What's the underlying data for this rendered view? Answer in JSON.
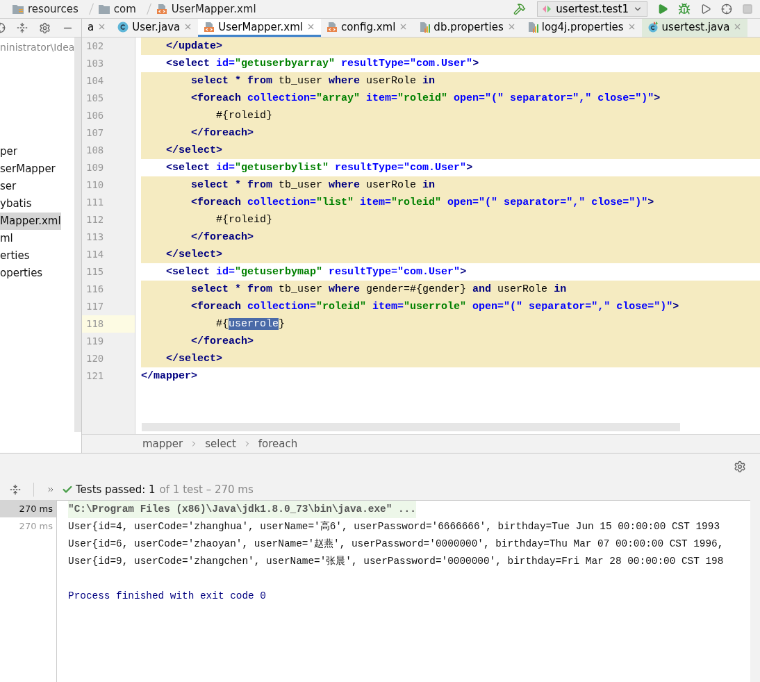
{
  "nav_bar": {
    "breadcrumbs": [
      {
        "text": "resources",
        "kind": "resources"
      },
      {
        "text": "com",
        "kind": "folder"
      },
      {
        "text": "UserMapper.xml",
        "kind": "xml"
      }
    ],
    "run_config": "usertest.test1"
  },
  "project_panel": {
    "tree_items": [
      {
        "text": "ninistrator\\Idea",
        "kind": "path",
        "selected": false
      },
      {
        "text": "per",
        "kind": "node",
        "selected": false
      },
      {
        "text": "serMapper",
        "kind": "node",
        "selected": false
      },
      {
        "text": "ser",
        "kind": "node",
        "selected": false
      },
      {
        "text": "ybatis",
        "kind": "node",
        "selected": false
      },
      {
        "text": "Mapper.xml",
        "kind": "node",
        "selected": true
      },
      {
        "text": "ml",
        "kind": "node",
        "selected": false
      },
      {
        "text": "erties",
        "kind": "node",
        "selected": false
      },
      {
        "text": "operties",
        "kind": "node",
        "selected": false
      }
    ]
  },
  "editor_tabs": [
    {
      "label": "a",
      "kind": "none",
      "selected": false
    },
    {
      "label": "User.java",
      "kind": "class",
      "selected": false
    },
    {
      "label": "UserMapper.xml",
      "kind": "xml",
      "selected": true
    },
    {
      "label": "config.xml",
      "kind": "xml",
      "selected": false
    },
    {
      "label": "db.properties",
      "kind": "properties",
      "selected": false
    },
    {
      "label": "log4j.properties",
      "kind": "properties",
      "selected": false
    },
    {
      "label": "usertest.java",
      "kind": "test-class",
      "selected": false
    }
  ],
  "editor": {
    "lines": [
      {
        "number": "102",
        "highlighted": true,
        "current": false,
        "tokens": [
          {
            "text": "    </update>",
            "kind": "tag"
          }
        ]
      },
      {
        "number": "103",
        "highlighted": false,
        "current": false,
        "tokens": [
          {
            "text": "    <select",
            "kind": "tag"
          },
          {
            "text": " id=",
            "kind": "attr"
          },
          {
            "text": "\"getuserbyarray\"",
            "kind": "value"
          },
          {
            "text": " resultType=\"com.User\"",
            "kind": "attr"
          },
          {
            "text": ">",
            "kind": "tag"
          }
        ]
      },
      {
        "number": "104",
        "highlighted": true,
        "current": false,
        "tokens": [
          {
            "text": "        select * from",
            "kind": "keyword"
          },
          {
            "text": " tb_user ",
            "kind": "text"
          },
          {
            "text": "where",
            "kind": "keyword"
          },
          {
            "text": " userRole ",
            "kind": "text"
          },
          {
            "text": "in",
            "kind": "keyword"
          }
        ]
      },
      {
        "number": "105",
        "highlighted": true,
        "current": false,
        "tokens": [
          {
            "text": "        <foreach",
            "kind": "tag"
          },
          {
            "text": " collection=",
            "kind": "attr"
          },
          {
            "text": "\"array\"",
            "kind": "value"
          },
          {
            "text": " item=",
            "kind": "attr"
          },
          {
            "text": "\"roleid\"",
            "kind": "value"
          },
          {
            "text": " open=\"(\" separator=\",\" close=\")\"",
            "kind": "attr"
          },
          {
            "text": ">",
            "kind": "tag"
          }
        ]
      },
      {
        "number": "106",
        "highlighted": true,
        "current": false,
        "tokens": [
          {
            "text": "            #{roleid}",
            "kind": "text"
          }
        ]
      },
      {
        "number": "107",
        "highlighted": true,
        "current": false,
        "tokens": [
          {
            "text": "        </foreach>",
            "kind": "tag"
          }
        ]
      },
      {
        "number": "108",
        "highlighted": true,
        "current": false,
        "tokens": [
          {
            "text": "    </select>",
            "kind": "tag"
          }
        ]
      },
      {
        "number": "109",
        "highlighted": false,
        "current": false,
        "tokens": [
          {
            "text": "    <select",
            "kind": "tag"
          },
          {
            "text": " id=",
            "kind": "attr"
          },
          {
            "text": "\"getuserbylist\"",
            "kind": "value"
          },
          {
            "text": " resultType=\"com.User\"",
            "kind": "attr"
          },
          {
            "text": ">",
            "kind": "tag"
          }
        ]
      },
      {
        "number": "110",
        "highlighted": true,
        "current": false,
        "tokens": [
          {
            "text": "        select * from",
            "kind": "keyword"
          },
          {
            "text": " tb_user ",
            "kind": "text"
          },
          {
            "text": "where",
            "kind": "keyword"
          },
          {
            "text": " userRole ",
            "kind": "text"
          },
          {
            "text": "in",
            "kind": "keyword"
          }
        ]
      },
      {
        "number": "111",
        "highlighted": true,
        "current": false,
        "tokens": [
          {
            "text": "        <foreach",
            "kind": "tag"
          },
          {
            "text": " collection=",
            "kind": "attr"
          },
          {
            "text": "\"list\"",
            "kind": "value"
          },
          {
            "text": " item=",
            "kind": "attr"
          },
          {
            "text": "\"roleid\"",
            "kind": "value"
          },
          {
            "text": " open=\"(\" separator=\",\" close=\")\"",
            "kind": "attr"
          },
          {
            "text": ">",
            "kind": "tag"
          }
        ]
      },
      {
        "number": "112",
        "highlighted": true,
        "current": false,
        "tokens": [
          {
            "text": "            #{roleid}",
            "kind": "text"
          }
        ]
      },
      {
        "number": "113",
        "highlighted": true,
        "current": false,
        "tokens": [
          {
            "text": "        </foreach>",
            "kind": "tag"
          }
        ]
      },
      {
        "number": "114",
        "highlighted": true,
        "current": false,
        "tokens": [
          {
            "text": "    </select>",
            "kind": "tag"
          }
        ]
      },
      {
        "number": "115",
        "highlighted": false,
        "current": false,
        "tokens": [
          {
            "text": "    <select",
            "kind": "tag"
          },
          {
            "text": " id=",
            "kind": "attr"
          },
          {
            "text": "\"getuserbymap\"",
            "kind": "value"
          },
          {
            "text": " resultType=\"com.User\"",
            "kind": "attr"
          },
          {
            "text": ">",
            "kind": "tag"
          }
        ]
      },
      {
        "number": "116",
        "highlighted": true,
        "current": false,
        "tokens": [
          {
            "text": "        select * from",
            "kind": "keyword"
          },
          {
            "text": " tb_user ",
            "kind": "text"
          },
          {
            "text": "where",
            "kind": "keyword"
          },
          {
            "text": " gender=#{gender} ",
            "kind": "text"
          },
          {
            "text": "and",
            "kind": "keyword"
          },
          {
            "text": " userRole ",
            "kind": "text"
          },
          {
            "text": "in",
            "kind": "keyword"
          }
        ]
      },
      {
        "number": "117",
        "highlighted": true,
        "current": false,
        "tokens": [
          {
            "text": "        <foreach",
            "kind": "tag"
          },
          {
            "text": " collection=",
            "kind": "attr"
          },
          {
            "text": "\"roleid\"",
            "kind": "value"
          },
          {
            "text": " item=",
            "kind": "attr"
          },
          {
            "text": "\"userrole\"",
            "kind": "value"
          },
          {
            "text": " open=\"(\" separator=\",\" close=\")\"",
            "kind": "attr"
          },
          {
            "text": ">",
            "kind": "tag"
          }
        ]
      },
      {
        "number": "118",
        "highlighted": true,
        "current": true,
        "tokens": [
          {
            "text": "            #{",
            "kind": "text"
          },
          {
            "text": "userrole",
            "kind": "selection"
          },
          {
            "text": "}",
            "kind": "text"
          }
        ]
      },
      {
        "number": "119",
        "highlighted": true,
        "current": false,
        "tokens": [
          {
            "text": "        </foreach>",
            "kind": "tag"
          }
        ]
      },
      {
        "number": "120",
        "highlighted": true,
        "current": false,
        "tokens": [
          {
            "text": "    </select>",
            "kind": "tag"
          }
        ]
      },
      {
        "number": "121",
        "highlighted": false,
        "current": false,
        "tokens": [
          {
            "text": "</mapper>",
            "kind": "tag"
          }
        ]
      }
    ]
  },
  "structure_path": [
    "mapper",
    "select",
    "foreach"
  ],
  "test_runner": {
    "status": "Tests passed: 1",
    "summary": "of 1 test – 270 ms",
    "durations": [
      {
        "text": "270 ms",
        "selected": true
      },
      {
        "text": "270 ms",
        "selected": false
      }
    ]
  },
  "console": {
    "lines": [
      {
        "kind": "command",
        "text": "\"C:\\Program Files (x86)\\Java\\jdk1.8.0_73\\bin\\java.exe\" ..."
      },
      {
        "kind": "output",
        "text": "User{id=4, userCode='zhanghua', userName='高6', userPassword='6666666', birthday=Tue Jun 15 00:00:00 CST 1993"
      },
      {
        "kind": "output",
        "text": "User{id=6, userCode='zhaoyan', userName='赵燕', userPassword='0000000', birthday=Thu Mar 07 00:00:00 CST 1996,"
      },
      {
        "kind": "output",
        "text": "User{id=9, userCode='zhangchen', userName='张晨', userPassword='0000000', birthday=Fri Mar 28 00:00:00 CST 198"
      },
      {
        "kind": "gap"
      },
      {
        "kind": "exit",
        "text": "Process finished with exit code 0"
      }
    ]
  }
}
